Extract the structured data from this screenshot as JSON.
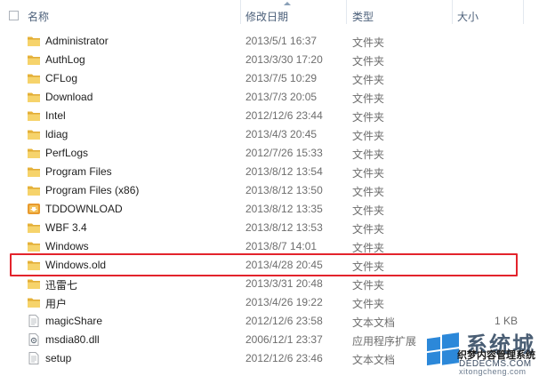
{
  "columns": {
    "name": "名称",
    "date": "修改日期",
    "type": "类型",
    "size": "大小"
  },
  "files": [
    {
      "name": "Administrator",
      "date": "2013/5/1 16:37",
      "type": "文件夹",
      "size": "",
      "icon": "folder-icon"
    },
    {
      "name": "AuthLog",
      "date": "2013/3/30 17:20",
      "type": "文件夹",
      "size": "",
      "icon": "folder-icon"
    },
    {
      "name": "CFLog",
      "date": "2013/7/5 10:29",
      "type": "文件夹",
      "size": "",
      "icon": "folder-icon"
    },
    {
      "name": "Download",
      "date": "2013/7/3 20:05",
      "type": "文件夹",
      "size": "",
      "icon": "folder-icon"
    },
    {
      "name": "Intel",
      "date": "2012/12/6 23:44",
      "type": "文件夹",
      "size": "",
      "icon": "folder-icon"
    },
    {
      "name": "ldiag",
      "date": "2013/4/3 20:45",
      "type": "文件夹",
      "size": "",
      "icon": "folder-icon"
    },
    {
      "name": "PerfLogs",
      "date": "2012/7/26 15:33",
      "type": "文件夹",
      "size": "",
      "icon": "folder-icon"
    },
    {
      "name": "Program Files",
      "date": "2013/8/12 13:54",
      "type": "文件夹",
      "size": "",
      "icon": "folder-icon"
    },
    {
      "name": "Program Files (x86)",
      "date": "2013/8/12 13:50",
      "type": "文件夹",
      "size": "",
      "icon": "folder-icon"
    },
    {
      "name": "TDDOWNLOAD",
      "date": "2013/8/12 13:35",
      "type": "文件夹",
      "size": "",
      "icon": "download-folder-icon"
    },
    {
      "name": "WBF 3.4",
      "date": "2013/8/12 13:53",
      "type": "文件夹",
      "size": "",
      "icon": "folder-icon"
    },
    {
      "name": "Windows",
      "date": "2013/8/7 14:01",
      "type": "文件夹",
      "size": "",
      "icon": "folder-icon"
    },
    {
      "name": "Windows.old",
      "date": "2013/4/28 20:45",
      "type": "文件夹",
      "size": "",
      "icon": "folder-icon"
    },
    {
      "name": "迅雷七",
      "date": "2013/3/31 20:48",
      "type": "文件夹",
      "size": "",
      "icon": "folder-icon"
    },
    {
      "name": "用户",
      "date": "2013/4/26 19:22",
      "type": "文件夹",
      "size": "",
      "icon": "folder-icon"
    },
    {
      "name": "magicShare",
      "date": "2012/12/6 23:58",
      "type": "文本文档",
      "size": "1 KB",
      "icon": "text-file-icon"
    },
    {
      "name": "msdia80.dll",
      "date": "2006/12/1 23:37",
      "type": "应用程序扩展",
      "size": "",
      "icon": "dll-file-icon"
    },
    {
      "name": "setup",
      "date": "2012/12/6 23:46",
      "type": "文本文档",
      "size": "",
      "icon": "text-file-icon"
    }
  ],
  "highlighted_item": "Windows.old",
  "watermark": {
    "title": "系统城",
    "subtitle": "织梦内容管理系统",
    "domain1": "DEDECMS.COM",
    "domain2": "xitongcheng.com"
  },
  "colors": {
    "header_text": "#4c607a",
    "highlight_border": "#e3232c",
    "folder": "#f2c94c",
    "download_folder": "#e8a23a"
  }
}
